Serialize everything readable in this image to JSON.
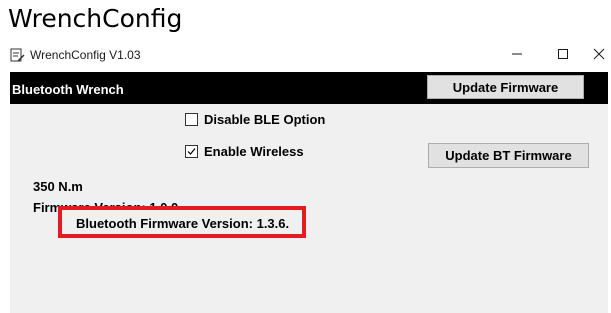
{
  "caption": "WrenchConfig",
  "window": {
    "title": "WrenchConfig V1.03",
    "icon": "notepad-pen-icon",
    "controls": {
      "minimize_icon": "minimize-icon",
      "maximize_icon": "maximize-icon",
      "close_icon": "close-icon"
    }
  },
  "header": {
    "title": "Bluetooth Wrench",
    "background": "#000000",
    "update_firmware_label": "Update Firmware"
  },
  "options": {
    "disable_ble": {
      "label": "Disable BLE Option",
      "checked": false
    },
    "enable_wireless": {
      "label": "Enable Wireless",
      "checked": true
    }
  },
  "update_bt_firmware_label": "Update BT Firmware",
  "info": {
    "torque": "350 N.m",
    "firmware_version": "Firmware Version: 1.0.0",
    "bt_firmware_version": "Bluetooth Firmware Version: 1.3.6."
  },
  "colors": {
    "highlight_border": "#e31b23",
    "client_background": "#f0f0f0"
  }
}
